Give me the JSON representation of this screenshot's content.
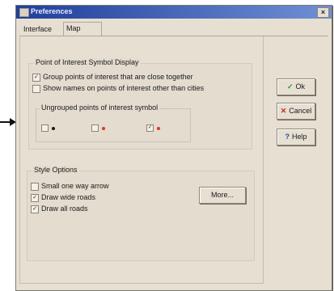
{
  "window": {
    "title": "Preferences"
  },
  "tabs": [
    {
      "label": "Interface"
    },
    {
      "label": "Map"
    }
  ],
  "poi": {
    "title": "Point of Interest Symbol Display",
    "options": [
      {
        "label": "Group points of interest that are close together",
        "checked": true
      },
      {
        "label": "Show names on points of interest other than cities",
        "checked": false
      }
    ],
    "ungrouped": {
      "title": "Ungrouped points of interest symbol",
      "choices": [
        {
          "checked": false,
          "dot_color": "#1a1a1a"
        },
        {
          "checked": false,
          "dot_color": "#d23a2a"
        },
        {
          "checked": true,
          "dot_color": "#d23a2a"
        }
      ]
    }
  },
  "style": {
    "title": "Style Options",
    "options": [
      {
        "label": "Small one way arrow",
        "checked": false
      },
      {
        "label": "Draw wide roads",
        "checked": true
      },
      {
        "label": "Draw all roads",
        "checked": true
      }
    ],
    "more_label": "More..."
  },
  "buttons": {
    "ok": "Ok",
    "cancel": "Cancel",
    "help": "Help"
  },
  "icons": {
    "ok": "check-icon",
    "cancel": "x-icon",
    "help": "question-icon",
    "close": "close-icon"
  },
  "colors": {
    "ok_icon": "#2a9a2a",
    "cancel_icon": "#cc2a1a",
    "help_icon": "#1f4fa8",
    "titlebar": "#1f3f9a"
  }
}
